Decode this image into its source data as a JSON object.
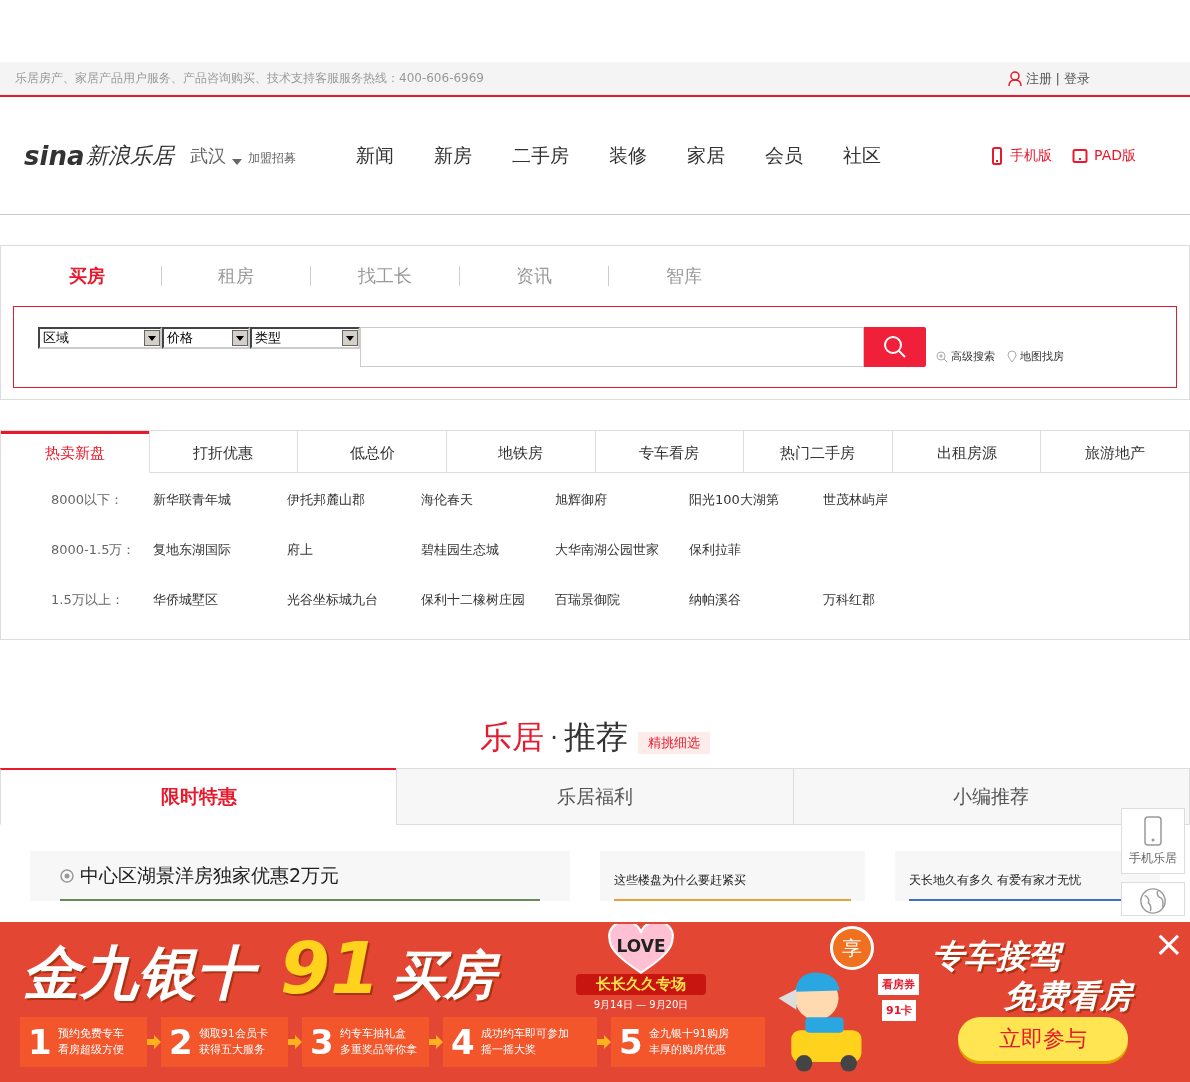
{
  "top_bar": {
    "hotline": "乐居房产、家居产品用户服务、产品咨询购买、技术支持客服服务热线：400-606-6969",
    "register": "注册",
    "separator": "|",
    "login": "登录"
  },
  "header": {
    "logo_mark": "sina",
    "logo_text": "新浪乐居",
    "city": "武汉",
    "join": "加盟招募",
    "nav": [
      "新闻",
      "新房",
      "二手房",
      "装修",
      "家居",
      "会员",
      "社区"
    ],
    "devices": [
      {
        "kind": "phone",
        "label": "手机版"
      },
      {
        "kind": "pad",
        "label": "PAD版"
      }
    ]
  },
  "search": {
    "tabs": [
      {
        "label": "买房",
        "selected": true
      },
      {
        "label": "租房",
        "selected": false
      },
      {
        "label": "找工长",
        "selected": false
      },
      {
        "label": "资讯",
        "selected": false
      },
      {
        "label": "智库",
        "selected": false
      }
    ],
    "selects": [
      "区域",
      "价格",
      "类型"
    ],
    "advanced": "高级搜索",
    "map": "地图找房"
  },
  "hot": {
    "tabs": [
      {
        "label": "热卖新盘",
        "selected": true
      },
      {
        "label": "打折优惠",
        "selected": false
      },
      {
        "label": "低总价",
        "selected": false
      },
      {
        "label": "地铁房",
        "selected": false
      },
      {
        "label": "专车看房",
        "selected": false
      },
      {
        "label": "热门二手房",
        "selected": false
      },
      {
        "label": "出租房源",
        "selected": false
      },
      {
        "label": "旅游地产",
        "selected": false
      }
    ],
    "rows": [
      {
        "label": "8000以下：",
        "items": [
          "新华联青年城",
          "伊托邦麓山郡",
          "海伦春天",
          "旭辉御府",
          "阳光100大湖第",
          "世茂林屿岸"
        ]
      },
      {
        "label": "8000-1.5万：",
        "items": [
          "复地东湖国际",
          "府上",
          "碧桂园生态城",
          "大华南湖公园世家",
          "保利拉菲"
        ]
      },
      {
        "label": "1.5万以上：",
        "items": [
          "华侨城墅区",
          "光谷坐标城九台",
          "保利十二橡树庄园",
          "百瑞景御院",
          "纳帕溪谷",
          "万科红郡"
        ]
      }
    ]
  },
  "recommend": {
    "title_a": "乐居",
    "dot": "·",
    "title_b": "推荐",
    "tag": "精挑细选",
    "tabs": [
      {
        "label": "限时特惠",
        "selected": true
      },
      {
        "label": "乐居福利",
        "selected": false
      },
      {
        "label": "小编推荐",
        "selected": false
      }
    ],
    "main_card": "中心区湖景洋房独家优惠2万元",
    "cards": [
      "这些楼盘为什么要赶紧买",
      "天长地久有多久 有爱有家才无忧"
    ]
  },
  "side": [
    {
      "kind": "phone",
      "label": "手机乐居"
    },
    {
      "kind": "map"
    }
  ],
  "banner": {
    "headline_a": "金九银十",
    "headline_b": "91",
    "headline_c": "买房",
    "steps": [
      {
        "num": "1",
        "lines": [
          "预约免费专车",
          "看房超级方便"
        ]
      },
      {
        "num": "2",
        "lines": [
          "领取91会员卡",
          "获得五大服务"
        ]
      },
      {
        "num": "3",
        "lines": [
          "约专车抽礼盒",
          "多重奖品等你拿"
        ]
      },
      {
        "num": "4",
        "lines": [
          "成功约车即可参加",
          "摇一摇大奖"
        ]
      },
      {
        "num": "5",
        "lines": [
          "金九银十91购房",
          "丰厚的购房优惠"
        ]
      }
    ],
    "love": "LOVE",
    "special": "长长久久专场",
    "dates": "9月14日 — 9月20日",
    "badge": "享",
    "ticket_a": "看房券",
    "ticket_b": "91卡",
    "slogan_a": "专车接驾",
    "slogan_b": "免费看房",
    "cta": "立即参与",
    "close": "×"
  }
}
